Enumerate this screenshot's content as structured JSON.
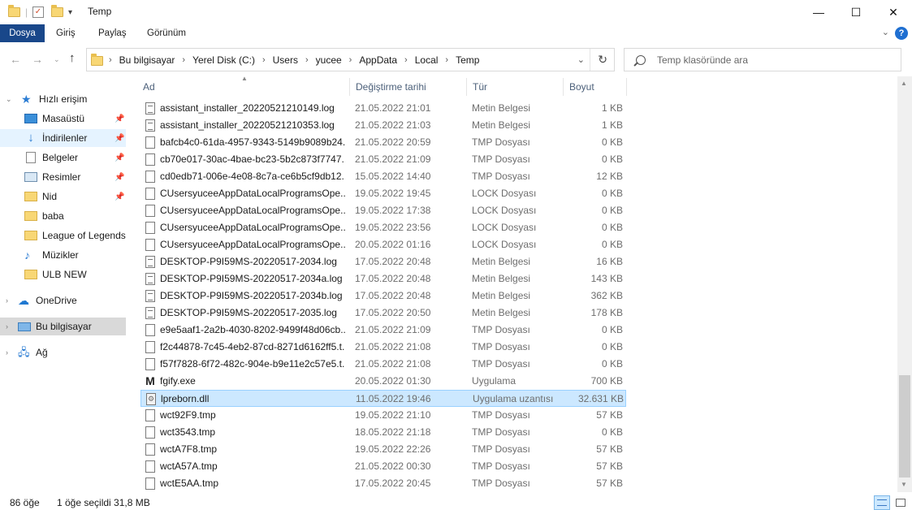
{
  "window": {
    "title": "Temp",
    "minimize": "—",
    "maximize": "☐",
    "close": "✕"
  },
  "ribbon": {
    "tabs": [
      "Dosya",
      "Giriş",
      "Paylaş",
      "Görünüm"
    ],
    "help": "?"
  },
  "address": {
    "crumbs": [
      "Bu bilgisayar",
      "Yerel Disk (C:)",
      "Users",
      "yucee",
      "AppData",
      "Local",
      "Temp"
    ],
    "search_placeholder": "Temp klasöründe ara"
  },
  "nav": {
    "items": [
      {
        "label": "Hızlı erişim",
        "icon": "star-icon"
      },
      {
        "label": "Masaüstü",
        "icon": "desktop-icon"
      },
      {
        "label": "İndirilenler",
        "icon": "download-icon"
      },
      {
        "label": "Belgeler",
        "icon": "documents-icon"
      },
      {
        "label": "Resimler",
        "icon": "pictures-icon"
      },
      {
        "label": "Nid",
        "icon": "folder-icon"
      },
      {
        "label": "baba",
        "icon": "folder-icon"
      },
      {
        "label": "League of Legends",
        "icon": "folder-icon"
      },
      {
        "label": "Müzikler",
        "icon": "music-icon"
      },
      {
        "label": "ULB NEW",
        "icon": "folder-icon"
      },
      {
        "label": "OneDrive",
        "icon": "cloud-icon"
      },
      {
        "label": "Bu bilgisayar",
        "icon": "computer-icon"
      },
      {
        "label": "Ağ",
        "icon": "network-icon"
      }
    ]
  },
  "columns": {
    "name": "Ad",
    "date": "Değiştirme tarihi",
    "type": "Tür",
    "size": "Boyut"
  },
  "files": [
    {
      "name": "assistant_installer_20220521210149.log",
      "date": "21.05.2022 21:01",
      "type": "Metin Belgesi",
      "size": "1 KB",
      "icon": "log"
    },
    {
      "name": "assistant_installer_20220521210353.log",
      "date": "21.05.2022 21:03",
      "type": "Metin Belgesi",
      "size": "1 KB",
      "icon": "log"
    },
    {
      "name": "bafcb4c0-61da-4957-9343-5149b9089b24...",
      "date": "21.05.2022 20:59",
      "type": "TMP Dosyası",
      "size": "0 KB",
      "icon": "file"
    },
    {
      "name": "cb70e017-30ac-4bae-bc23-5b2c873f7747....",
      "date": "21.05.2022 21:09",
      "type": "TMP Dosyası",
      "size": "0 KB",
      "icon": "file"
    },
    {
      "name": "cd0edb71-006e-4e08-8c7a-ce6b5cf9db12....",
      "date": "15.05.2022 14:40",
      "type": "TMP Dosyası",
      "size": "12 KB",
      "icon": "file"
    },
    {
      "name": "CUsersyuceeAppDataLocalProgramsOpe...",
      "date": "19.05.2022 19:45",
      "type": "LOCK Dosyası",
      "size": "0 KB",
      "icon": "file"
    },
    {
      "name": "CUsersyuceeAppDataLocalProgramsOpe...",
      "date": "19.05.2022 17:38",
      "type": "LOCK Dosyası",
      "size": "0 KB",
      "icon": "file"
    },
    {
      "name": "CUsersyuceeAppDataLocalProgramsOpe...",
      "date": "19.05.2022 23:56",
      "type": "LOCK Dosyası",
      "size": "0 KB",
      "icon": "file"
    },
    {
      "name": "CUsersyuceeAppDataLocalProgramsOpe...",
      "date": "20.05.2022 01:16",
      "type": "LOCK Dosyası",
      "size": "0 KB",
      "icon": "file"
    },
    {
      "name": "DESKTOP-P9I59MS-20220517-2034.log",
      "date": "17.05.2022 20:48",
      "type": "Metin Belgesi",
      "size": "16 KB",
      "icon": "log"
    },
    {
      "name": "DESKTOP-P9I59MS-20220517-2034a.log",
      "date": "17.05.2022 20:48",
      "type": "Metin Belgesi",
      "size": "143 KB",
      "icon": "log"
    },
    {
      "name": "DESKTOP-P9I59MS-20220517-2034b.log",
      "date": "17.05.2022 20:48",
      "type": "Metin Belgesi",
      "size": "362 KB",
      "icon": "log"
    },
    {
      "name": "DESKTOP-P9I59MS-20220517-2035.log",
      "date": "17.05.2022 20:50",
      "type": "Metin Belgesi",
      "size": "178 KB",
      "icon": "log"
    },
    {
      "name": "e9e5aaf1-2a2b-4030-8202-9499f48d06cb....",
      "date": "21.05.2022 21:09",
      "type": "TMP Dosyası",
      "size": "0 KB",
      "icon": "file"
    },
    {
      "name": "f2c44878-7c45-4eb2-87cd-8271d6162ff5.t...",
      "date": "21.05.2022 21:08",
      "type": "TMP Dosyası",
      "size": "0 KB",
      "icon": "file"
    },
    {
      "name": "f57f7828-6f72-482c-904e-b9e11e2c57e5.t...",
      "date": "21.05.2022 21:08",
      "type": "TMP Dosyası",
      "size": "0 KB",
      "icon": "file"
    },
    {
      "name": "fgify.exe",
      "date": "20.05.2022 01:30",
      "type": "Uygulama",
      "size": "700 KB",
      "icon": "exe"
    },
    {
      "name": "lpreborn.dll",
      "date": "11.05.2022 19:46",
      "type": "Uygulama uzantısı",
      "size": "32.631 KB",
      "icon": "dll",
      "selected": true
    },
    {
      "name": "wct92F9.tmp",
      "date": "19.05.2022 21:10",
      "type": "TMP Dosyası",
      "size": "57 KB",
      "icon": "file"
    },
    {
      "name": "wct3543.tmp",
      "date": "18.05.2022 21:18",
      "type": "TMP Dosyası",
      "size": "0 KB",
      "icon": "file"
    },
    {
      "name": "wctA7F8.tmp",
      "date": "19.05.2022 22:26",
      "type": "TMP Dosyası",
      "size": "57 KB",
      "icon": "file"
    },
    {
      "name": "wctA57A.tmp",
      "date": "21.05.2022 00:30",
      "type": "TMP Dosyası",
      "size": "57 KB",
      "icon": "file"
    },
    {
      "name": "wctE5AA.tmp",
      "date": "17.05.2022 20:45",
      "type": "TMP Dosyası",
      "size": "57 KB",
      "icon": "file"
    }
  ],
  "status": {
    "count": "86 öğe",
    "selection": "1 öğe seçildi  31,8 MB"
  }
}
